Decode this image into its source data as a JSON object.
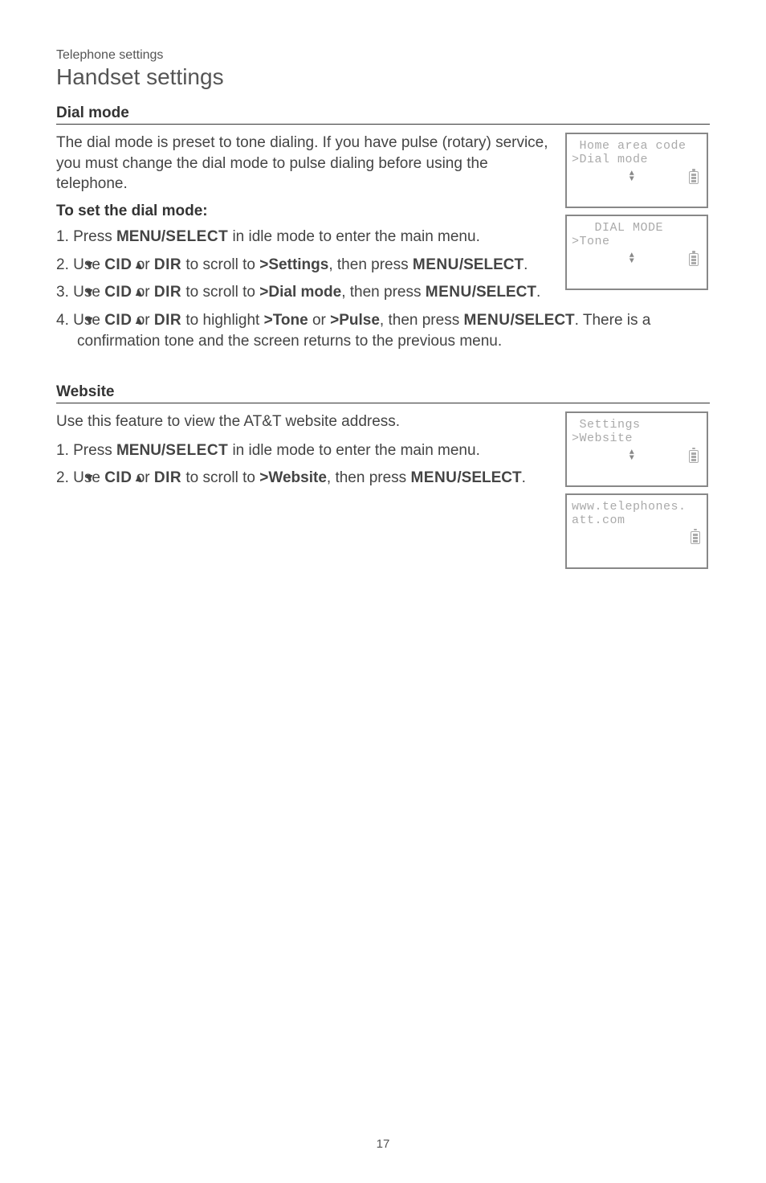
{
  "header": {
    "small": "Telephone settings",
    "large": "Handset settings"
  },
  "dial": {
    "title": "Dial mode",
    "intro": "The dial mode is preset to tone dialing. If you have pulse (rotary) service, you must change the dial mode to pulse dialing before using the telephone.",
    "subhead": "To set the dial mode:",
    "steps": {
      "s1_a": "1. Press ",
      "s1_b": "MENU/",
      "s1_c": "SELECT",
      "s1_d": " in idle mode to enter the main menu.",
      "s2_a": "2. Use ",
      "s2_cid": "CID",
      "s2_or": " or ",
      "s2_dir": "DIR",
      "s2_b": " to scroll to ",
      "s2_target": ">Settings",
      "s2_c": ", then press ",
      "s2_menu": "MENU",
      "s2_sel": "/SELECT",
      "s2_end": ".",
      "s3_a": "3. Use ",
      "s3_cid": "CID",
      "s3_or": " or ",
      "s3_dir": "DIR",
      "s3_b": " to scroll to ",
      "s3_target": ">Dial mode",
      "s3_c": ", then press ",
      "s3_menu": "MENU",
      "s3_sel": "/SELECT",
      "s3_end": ".",
      "s4_a": "4. Use ",
      "s4_cid": "CID",
      "s4_or": " or ",
      "s4_dir": "DIR",
      "s4_b": " to highlight ",
      "s4_t1": ">Tone",
      "s4_or2": " or ",
      "s4_t2": ">Pulse",
      "s4_c": ", then press ",
      "s4_menu": "MENU",
      "s4_sel": "/SELECT",
      "s4_end": ". There is a confirmation tone and the screen returns to the previous menu."
    },
    "lcd1": {
      "l1": " Home area code",
      "l2": ">Dial mode"
    },
    "lcd2": {
      "l1": "   DIAL MODE",
      "l2": ">Tone"
    }
  },
  "website": {
    "title": "Website",
    "intro": "Use this feature to view the AT&T website address.",
    "steps": {
      "s1_a": "1. Press ",
      "s1_b": "MENU/",
      "s1_c": "SELECT",
      "s1_d": " in idle mode to enter the main menu.",
      "s2_a": "2. Use ",
      "s2_cid": "CID",
      "s2_or": " or ",
      "s2_dir": "DIR",
      "s2_b": " to scroll to ",
      "s2_target": ">Website",
      "s2_c": ", then press ",
      "s2_menu": "MENU",
      "s2_sel": "/SELECT",
      "s2_end": "."
    },
    "lcd1": {
      "l1": " Settings",
      "l2": ">Website"
    },
    "lcd2": {
      "l1": "www.telephones.",
      "l2": "att.com"
    }
  },
  "page": "17"
}
